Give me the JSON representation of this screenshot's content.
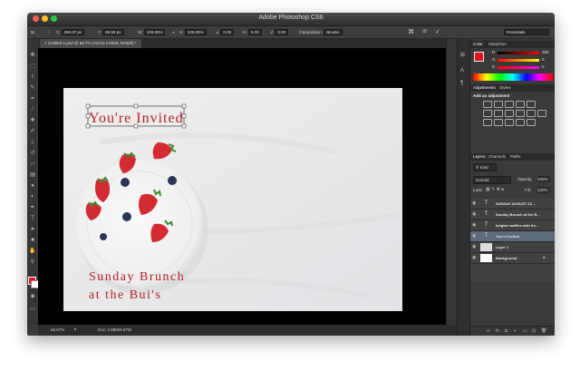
{
  "window": {
    "title": "Adobe Photoshop CS6"
  },
  "options_bar": {
    "x_label": "X:",
    "x_value": "260.07 px",
    "y_label": "Y:",
    "y_value": "89.59 px",
    "w_label": "W:",
    "w_value": "100.00%",
    "h_label": "H:",
    "h_value": "100.00%",
    "angle_value": "0.00",
    "h_skew_label": "H:",
    "h_skew_value": "0.00",
    "v_skew_label": "V:",
    "v_skew_value": "0.00",
    "interpolation_label": "Interpolation:",
    "interpolation_value": "Bicubic",
    "workspace": "Essentials"
  },
  "document_tab": {
    "label": "Untitled-1.psd @ 66.7% (You're Invited, RGB/8) *"
  },
  "canvas_text": {
    "invited": "You're Invited",
    "line1": "Sunday Brunch",
    "line2": "at the Bui's"
  },
  "status": {
    "zoom": "66.67%",
    "doc": "Doc: 2.88M/9.67M"
  },
  "color_panel": {
    "tabs": [
      "Color",
      "Swatches"
    ],
    "r_label": "R",
    "r_value": "255",
    "g_label": "G",
    "g_value": "0",
    "b_label": "B",
    "b_value": "0"
  },
  "adjustments_panel": {
    "tabs": [
      "Adjustments",
      "Styles"
    ],
    "subtitle": "Add an adjustment"
  },
  "layers_panel": {
    "tabs": [
      "Layers",
      "Channels",
      "Paths"
    ],
    "filter": "Kind",
    "blend_mode": "Normal",
    "opacity_label": "Opacity:",
    "opacity_value": "100%",
    "lock_label": "Lock:",
    "fill_label": "Fill:",
    "fill_value": "100%",
    "layers": [
      {
        "name": "SUNDAY AUGUST 10 ...",
        "type": "T"
      },
      {
        "name": "Sunday Brunch at the B...",
        "type": "T"
      },
      {
        "name": "belgian waffles with fre...",
        "type": "T"
      },
      {
        "name": "You're Invited",
        "type": "T"
      },
      {
        "name": "Layer 1",
        "type": "img"
      },
      {
        "name": "Background",
        "type": "bg"
      }
    ]
  },
  "colors": {
    "accent_red": "#b51f26",
    "selected_layer": "#5d6a7a",
    "foreground": "#e0151b"
  }
}
